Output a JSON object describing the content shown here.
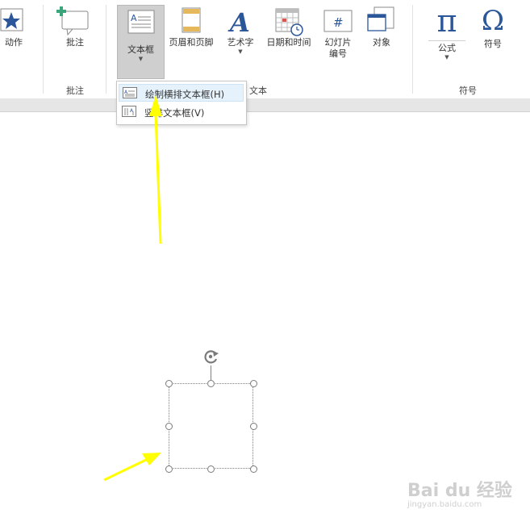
{
  "ribbon": {
    "groups": {
      "comments": {
        "label": "批注"
      },
      "text": {
        "label": "文本"
      },
      "symbols": {
        "label": "符号"
      }
    },
    "buttons": {
      "action": {
        "label": "动作"
      },
      "comment": {
        "label": "批注"
      },
      "textbox": {
        "label": "文本框"
      },
      "header_footer": {
        "label": "页眉和页脚"
      },
      "wordart": {
        "label": "艺术字"
      },
      "datetime": {
        "label": "日期和时间"
      },
      "slide_number": {
        "label_line1": "幻灯片",
        "label_line2": "编号"
      },
      "object": {
        "label": "对象"
      },
      "equation": {
        "label": "公式",
        "glyph": "π"
      },
      "symbol": {
        "label": "符号",
        "glyph": "Ω"
      }
    }
  },
  "dropdown": {
    "items": [
      {
        "label": "绘制横排文本框(H)"
      },
      {
        "label": "竖排文本框(V)"
      }
    ]
  },
  "watermark": {
    "main": "Bai du 经验",
    "sub": "jingyan.baidu.com"
  },
  "colors": {
    "accent": "#2b579a",
    "arrow": "#ffff00"
  }
}
